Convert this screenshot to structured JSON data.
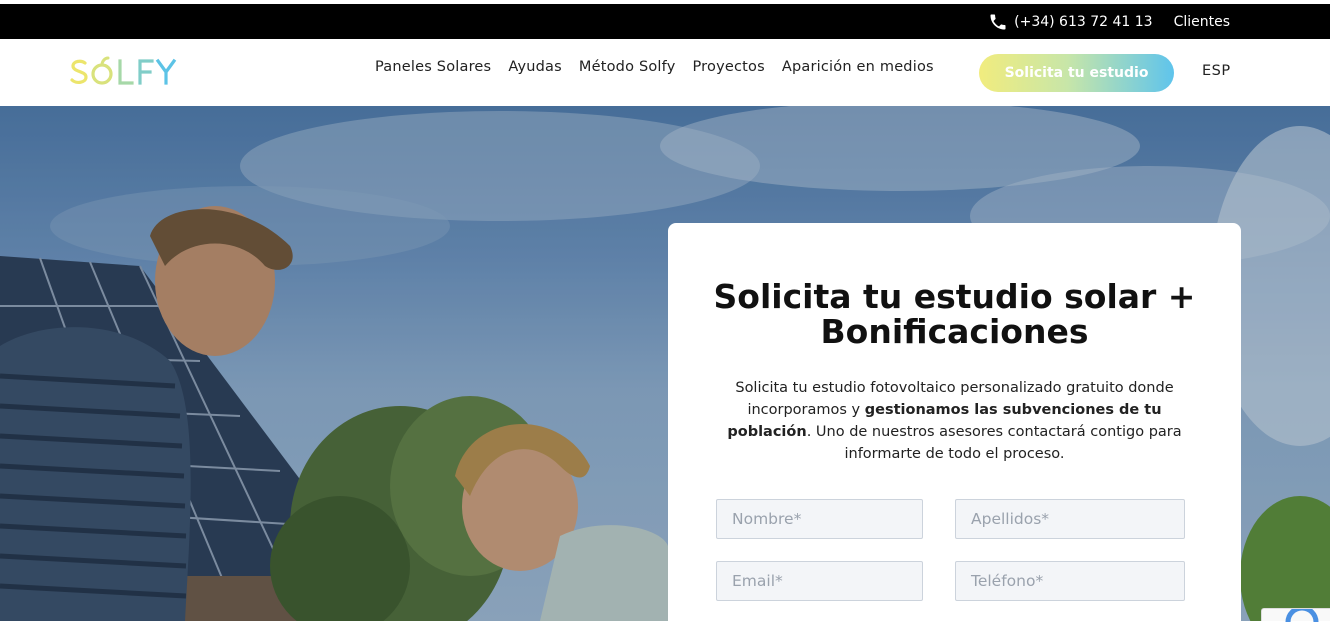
{
  "topbar": {
    "phone": "(+34) 613 72 41 13",
    "clients_link": "Clientes"
  },
  "header": {
    "logo_text": "SOLFY",
    "nav": [
      "Paneles Solares",
      "Ayudas",
      "Método Solfy",
      "Proyectos",
      "Aparición en medios"
    ],
    "cta_label": "Solicita tu estudio",
    "language": "ESP"
  },
  "form": {
    "title_line1": "Solicita tu estudio solar +",
    "title_line2": "Bonificaciones",
    "desc_part1": "Solicita tu estudio fotovoltaico personalizado gratuito donde incorporamos y ",
    "desc_bold": "gestionamos las subvenciones de tu población",
    "desc_part2": ". Uno de nuestros asesores contactará contigo para informarte de todo el proceso.",
    "fields": {
      "nombre": "Nombre*",
      "apellidos": "Apellidos*",
      "email": "Email*",
      "telefono": "Teléfono*"
    }
  },
  "colors": {
    "cta_gradient_start": "#f1ec7e",
    "cta_gradient_end": "#5fc4ec",
    "logo_yellow": "#e9e36a",
    "logo_blue": "#5cc3e6"
  }
}
